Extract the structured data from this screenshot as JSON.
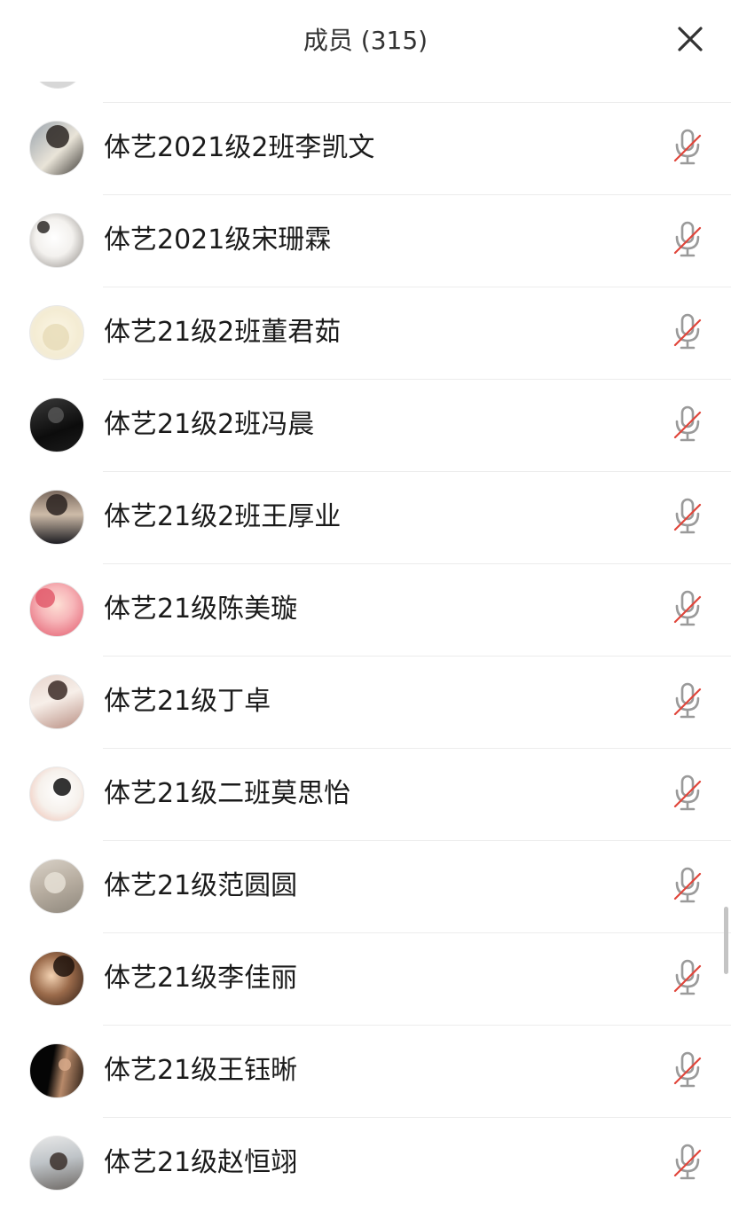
{
  "header": {
    "title": "成员 (315)",
    "close_icon": "close-icon"
  },
  "colors": {
    "background": "#ffffff",
    "text": "#1a1a1a",
    "title_text": "#333333",
    "divider": "#ececec",
    "mic_gray": "#9a9a9a",
    "mic_slash_red": "#e0453a"
  },
  "members": [
    {
      "name": "体艺2021级2班李凯文",
      "mic_icon": "mic-muted-icon"
    },
    {
      "name": "体艺2021级宋珊霖",
      "mic_icon": "mic-muted-icon"
    },
    {
      "name": "体艺21级2班董君茹",
      "mic_icon": "mic-muted-icon"
    },
    {
      "name": "体艺21级2班冯晨",
      "mic_icon": "mic-muted-icon"
    },
    {
      "name": "体艺21级2班王厚业",
      "mic_icon": "mic-muted-icon"
    },
    {
      "name": "体艺21级陈美璇",
      "mic_icon": "mic-muted-icon"
    },
    {
      "name": "体艺21级丁卓",
      "mic_icon": "mic-muted-icon"
    },
    {
      "name": "体艺21级二班莫思怡",
      "mic_icon": "mic-muted-icon"
    },
    {
      "name": "体艺21级范圆圆",
      "mic_icon": "mic-muted-icon"
    },
    {
      "name": "体艺21级李佳丽",
      "mic_icon": "mic-muted-icon"
    },
    {
      "name": "体艺21级王钰晰",
      "mic_icon": "mic-muted-icon"
    },
    {
      "name": "体艺21级赵恒翊",
      "mic_icon": "mic-muted-icon"
    }
  ]
}
